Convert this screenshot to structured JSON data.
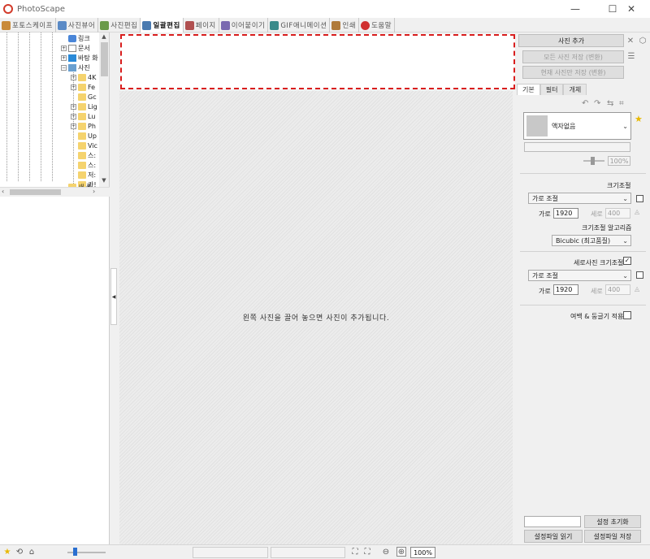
{
  "window": {
    "title": "PhotoScape",
    "min_glyph": "—",
    "max_glyph": "☐",
    "close_glyph": "✕"
  },
  "tabs": [
    {
      "label": "포토스케이프",
      "icon": "photoscape-home-icon",
      "color": "#c98a3a"
    },
    {
      "label": "사진뷰어",
      "icon": "viewer-icon",
      "color": "#5a8ac6"
    },
    {
      "label": "사진편집",
      "icon": "editor-icon",
      "color": "#6a9a4a"
    },
    {
      "label": "일괄편집",
      "icon": "batch-editor-icon",
      "color": "#4a7ab0",
      "active": true
    },
    {
      "label": "페이지",
      "icon": "page-icon",
      "color": "#b05050"
    },
    {
      "label": "이어붙이기",
      "icon": "combine-icon",
      "color": "#7a6ab0"
    },
    {
      "label": "GIF애니메이션",
      "icon": "gif-icon",
      "color": "#3a8a8a"
    },
    {
      "label": "인쇄",
      "icon": "print-icon",
      "color": "#b07a3a"
    },
    {
      "label": "도움말",
      "icon": "help-icon",
      "color": "#d03030"
    }
  ],
  "tree": {
    "items": [
      {
        "label": "링크",
        "expander": "",
        "icon": "link-folder-icon"
      },
      {
        "label": "문서",
        "expander": "+",
        "icon": "documents-icon"
      },
      {
        "label": "바탕 화",
        "expander": "+",
        "icon": "desktop-icon"
      },
      {
        "label": "사진",
        "expander": "−",
        "icon": "pictures-icon"
      },
      {
        "label": "4K",
        "expander": "+",
        "icon": "folder-icon"
      },
      {
        "label": "Fe",
        "expander": "+",
        "icon": "folder-icon"
      },
      {
        "label": "Gc",
        "expander": "",
        "icon": "folder-icon"
      },
      {
        "label": "Lig",
        "expander": "+",
        "icon": "folder-icon"
      },
      {
        "label": "Lu",
        "expander": "+",
        "icon": "folder-icon"
      },
      {
        "label": "Ph",
        "expander": "+",
        "icon": "folder-icon"
      },
      {
        "label": "Up",
        "expander": "",
        "icon": "folder-icon"
      },
      {
        "label": "Vic",
        "expander": "",
        "icon": "folder-icon"
      },
      {
        "label": "스:",
        "expander": "",
        "icon": "folder-icon"
      },
      {
        "label": "스:",
        "expander": "",
        "icon": "folder-icon"
      },
      {
        "label": "저:",
        "expander": "",
        "icon": "folder-icon"
      },
      {
        "label": "카!",
        "expander": "",
        "icon": "folder-icon"
      },
      {
        "label": "새 폴",
        "expander": "",
        "icon": "folder-icon"
      }
    ]
  },
  "canvas": {
    "drop_hint": "왼쪽 사진을 끌어 놓으면 사진이 추가됩니다."
  },
  "right_panel": {
    "add_photo": "사진 추가",
    "save_all": "모든 사진 저장 (변환)",
    "save_current": "현재 사진만 저장 (변환)",
    "subtabs": [
      "기본",
      "필터",
      "개체"
    ],
    "frame": {
      "selected": "액자없음"
    },
    "frame_zoom": "100%",
    "resize": {
      "title": "크기조절",
      "mode": "가로 조절",
      "width_label": "가로",
      "width_value": "1920",
      "height_label": "세로",
      "height_value": "400"
    },
    "algorithm": {
      "title": "크기조절 알고리즘",
      "value": "Bicubic (최고품질)"
    },
    "portrait": {
      "title": "세로사진 크기조절",
      "checked": "✓",
      "mode": "가로 조절",
      "width_label": "가로",
      "width_value": "1920",
      "height_label": "세로",
      "height_value": "400"
    },
    "margin_label": "여백 & 둥글기 적용",
    "reset_settings": "설정 초기화",
    "load_settings": "설정파일 읽기",
    "save_settings": "설정파일 저장"
  },
  "statusbar": {
    "zoom": "100%"
  },
  "colors": {
    "accent_red": "#d91e1e",
    "folder_yellow": "#f5d36e",
    "star_yellow": "#e8b800"
  }
}
